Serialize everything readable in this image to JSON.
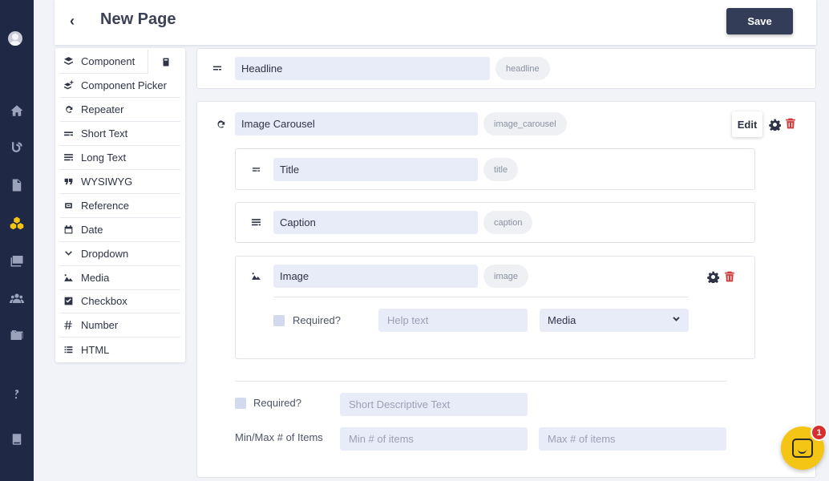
{
  "header": {
    "title": "New Page",
    "save_label": "Save"
  },
  "palette": {
    "items": [
      {
        "label": "Component",
        "icon": "layers-icon"
      },
      {
        "label": "Component Picker",
        "icon": "layers-plus-icon"
      },
      {
        "label": "Repeater",
        "icon": "repeat-icon"
      },
      {
        "label": "Short Text",
        "icon": "short-text-icon"
      },
      {
        "label": "Long Text",
        "icon": "long-text-icon"
      },
      {
        "label": "WYSIWYG",
        "icon": "quote-icon"
      },
      {
        "label": "Reference",
        "icon": "link-icon"
      },
      {
        "label": "Date",
        "icon": "calendar-icon"
      },
      {
        "label": "Dropdown",
        "icon": "chevron-down-icon"
      },
      {
        "label": "Media",
        "icon": "image-icon"
      },
      {
        "label": "Checkbox",
        "icon": "checkbox-icon"
      },
      {
        "label": "Number",
        "icon": "hash-icon"
      },
      {
        "label": "HTML",
        "icon": "list-icon"
      }
    ]
  },
  "headline": {
    "name": "Headline",
    "key": "headline"
  },
  "carousel": {
    "name": "Image Carousel",
    "key": "image_carousel",
    "edit_label": "Edit",
    "fields": {
      "title": {
        "name": "Title",
        "key": "title"
      },
      "caption": {
        "name": "Caption",
        "key": "caption"
      },
      "image": {
        "name": "Image",
        "key": "image",
        "required_label": "Required?",
        "help_placeholder": "Help text",
        "type_value": "Media"
      }
    },
    "required_label": "Required?",
    "desc_placeholder": "Short Descriptive Text",
    "minmax_label": "Min/Max # of Items",
    "min_placeholder": "Min # of items",
    "max_placeholder": "Max # of items"
  },
  "chat": {
    "badge": "1"
  },
  "colors": {
    "rail": "#1f2946",
    "save": "#333d57",
    "input": "#e8ecf9",
    "delete": "#cf3a3a",
    "chat": "#f5c516",
    "active_nav": "#f5c516"
  }
}
